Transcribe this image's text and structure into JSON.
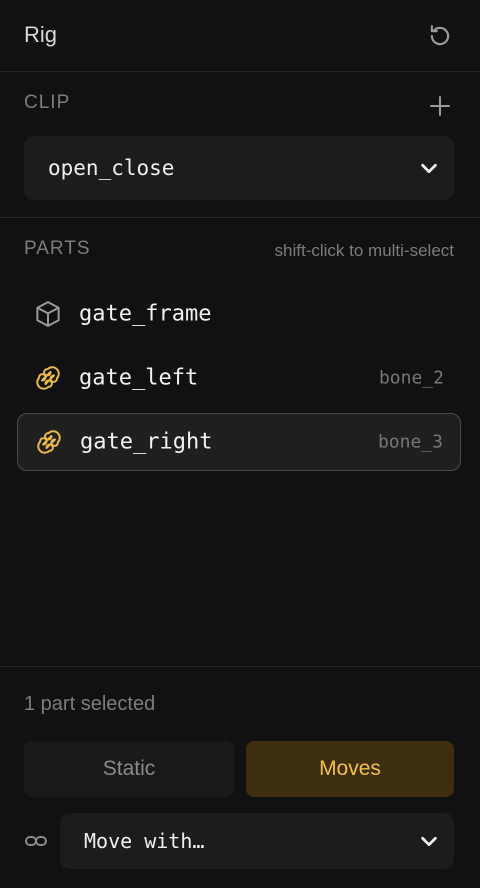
{
  "header": {
    "title": "Rig",
    "reset_icon": "reset-icon"
  },
  "clip": {
    "label": "CLIP",
    "add_icon": "plus-icon",
    "selected": "open_close"
  },
  "parts": {
    "label": "PARTS",
    "hint": "shift-click to multi-select",
    "items": [
      {
        "name": "gate_frame",
        "icon": "cube-icon",
        "bone": "",
        "selected": false
      },
      {
        "name": "gate_left",
        "icon": "bone-icon",
        "bone": "bone_2",
        "selected": false
      },
      {
        "name": "gate_right",
        "icon": "bone-icon",
        "bone": "bone_3",
        "selected": true
      }
    ]
  },
  "footer": {
    "selection_count": "1 part selected",
    "static_label": "Static",
    "moves_label": "Moves",
    "active_mode": "Moves",
    "move_with_placeholder": "Move with…",
    "link_icon": "link-icon"
  },
  "colors": {
    "background": "#111111",
    "accent": "#f2c14e",
    "accent_bg": "#3d2e10",
    "bone_icon": "#e9b949"
  }
}
